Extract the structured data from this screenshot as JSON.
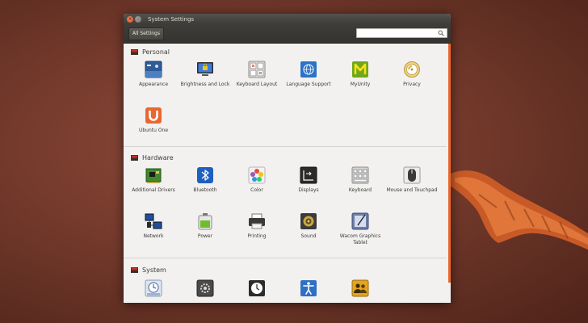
{
  "window": {
    "title": "System Settings",
    "close_glyph": "×",
    "min_glyph": "–"
  },
  "toolbar": {
    "all_settings_label": "All Settings",
    "search_value": "",
    "search_placeholder": ""
  },
  "sections": [
    {
      "title": "Personal",
      "items": [
        {
          "label": "Appearance",
          "icon": "appearance-icon"
        },
        {
          "label": "Brightness and Lock",
          "icon": "brightness-lock-icon"
        },
        {
          "label": "Keyboard Layout",
          "icon": "keyboard-layout-icon"
        },
        {
          "label": "Language Support",
          "icon": "language-support-icon"
        },
        {
          "label": "MyUnity",
          "icon": "myunity-icon"
        },
        {
          "label": "Privacy",
          "icon": "privacy-icon"
        },
        {
          "label": "Ubuntu One",
          "icon": "ubuntu-one-icon"
        }
      ]
    },
    {
      "title": "Hardware",
      "items": [
        {
          "label": "Additional Drivers",
          "icon": "additional-drivers-icon"
        },
        {
          "label": "Bluetooth",
          "icon": "bluetooth-icon"
        },
        {
          "label": "Color",
          "icon": "color-icon"
        },
        {
          "label": "Displays",
          "icon": "displays-icon"
        },
        {
          "label": "Keyboard",
          "icon": "keyboard-icon"
        },
        {
          "label": "Mouse and Touchpad",
          "icon": "mouse-touchpad-icon"
        },
        {
          "label": "Network",
          "icon": "network-icon"
        },
        {
          "label": "Power",
          "icon": "power-icon"
        },
        {
          "label": "Printing",
          "icon": "printing-icon"
        },
        {
          "label": "Sound",
          "icon": "sound-icon"
        },
        {
          "label": "Wacom Graphics Tablet",
          "icon": "wacom-tablet-icon"
        }
      ]
    },
    {
      "title": "System",
      "items": [
        {
          "label": "",
          "icon": "backups-icon"
        },
        {
          "label": "",
          "icon": "details-icon"
        },
        {
          "label": "",
          "icon": "time-date-icon"
        },
        {
          "label": "",
          "icon": "universal-access-icon"
        },
        {
          "label": "",
          "icon": "user-accounts-icon"
        }
      ]
    }
  ],
  "colors": {
    "accent": "#e9672f",
    "section_icon_red": "#d23a2e",
    "text": "#3c3b37"
  }
}
